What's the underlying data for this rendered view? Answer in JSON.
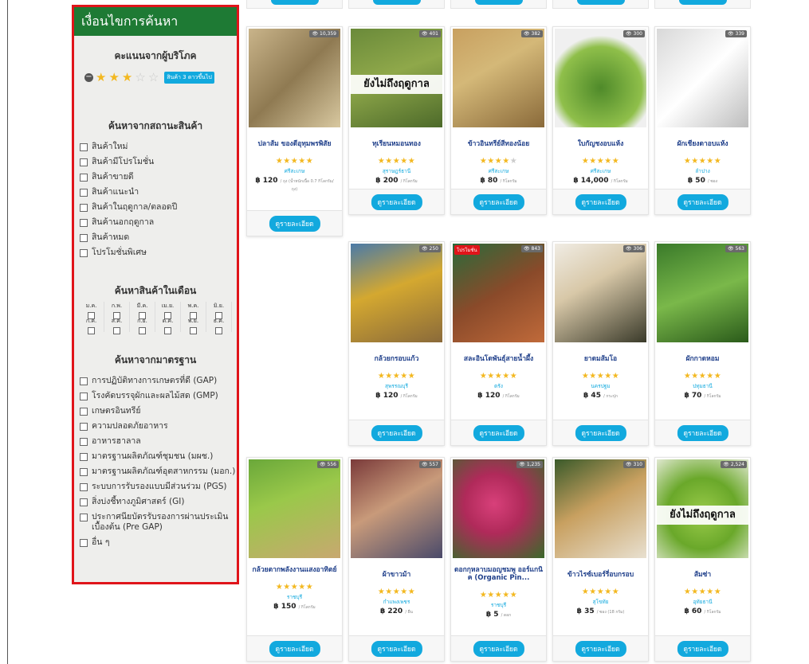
{
  "sidebar": {
    "title": "เงื่อนไขการค้นหา",
    "rating_heading": "คะแนนจากผู้บริโภค",
    "rating_badge": "สินค้า 3 ดาวขึ้นไป",
    "status_heading": "ค้นหาจากสถานะสินค้า",
    "status_items": [
      "สินค้าใหม่",
      "สินค้ามีโปรโมชั่น",
      "สินค้าขายดี",
      "สินค้าแนะนำ",
      "สินค้าในฤดูกาล/ตลอดปี",
      "สินค้านอกฤดูกาล",
      "สินค้าหมด",
      "โปรโมชั่นพิเศษ"
    ],
    "month_heading": "ค้นหาสินค้าในเดือน",
    "months": [
      "ม.ค.",
      "ก.พ.",
      "มี.ค.",
      "เม.ย.",
      "พ.ค.",
      "มิ.ย.",
      "ก.ค.",
      "ส.ค.",
      "ก.ย.",
      "ต.ค.",
      "พ.ย.",
      "ธ.ค."
    ],
    "standard_heading": "ค้นหาจากมาตรฐาน",
    "standard_items": [
      "การปฏิบัติทางการเกษตรที่ดี (GAP)",
      "โรงคัดบรรจุผักและผลไม้สด (GMP)",
      "เกษตรอินทรีย์",
      "ความปลอดภัยอาหาร",
      "อาหารฮาลาล",
      "มาตรฐานผลิตภัณฑ์ชุมชน (มผช.)",
      "มาตรฐานผลิตภัณฑ์อุตสาหกรรม (มอก.)",
      "ระบบการรับรองแบบมีส่วนร่วม (PGS)",
      "สิ่งบ่งชี้ทางภูมิศาสตร์ (GI)",
      "ประกาศนียบัตรรับรองการผ่านประเมินเบื้องต้น (Pre GAP)",
      "อื่น ๆ"
    ]
  },
  "detail_label": "ดูรายละเอียด",
  "off_season_label": "ยังไม่ถึงฤดูกาล",
  "promo_label": "โปรโมชั่น",
  "products": [
    {
      "name": "ปลาส้ม ของดีอุทุมพรพิสัย",
      "views": "10,359",
      "stars": 5,
      "province": "ศรีสะเกษ",
      "price": "฿ 120",
      "unit": "/ ถุง (น้ำหนักเนื้อ 0.7 กิโลกรัม/",
      "unit2": "ถุง)"
    },
    {
      "name": "ทุเรียนหมอนทอง",
      "views": "401",
      "stars": 5,
      "province": "สุราษฎร์ธานี",
      "price": "฿ 200",
      "unit": "/ กิโลกรัม",
      "off_season": true
    },
    {
      "name": "ข้าวอินทรีย์สีทองน้อย",
      "views": "382",
      "stars": 4,
      "province": "ศรีสะเกษ",
      "price": "฿ 80",
      "unit": "/ กิโลกรัม"
    },
    {
      "name": "ใบกัญชงอบแห้ง",
      "views": "300",
      "stars": 5,
      "province": "ศรีสะเกษ",
      "price": "฿ 14,000",
      "unit": "/ กิโลกรัม"
    },
    {
      "name": "ผักเชียงดาอบแห้ง",
      "views": "339",
      "stars": 5,
      "province": "ลำปาง",
      "price": "฿ 50",
      "unit": "/ ซอง"
    },
    {
      "name": "กล้วยกรอบแก้ว",
      "views": "250",
      "stars": 5,
      "province": "สุพรรณบุรี",
      "price": "฿ 120",
      "unit": "/ กิโลกรัม"
    },
    {
      "name": "สละอินโดพันธุ์สายน้ำผึ้ง",
      "views": "843",
      "stars": 5,
      "province": "ตรัง",
      "price": "฿ 120",
      "unit": "/ กิโลกรัม",
      "promo": true
    },
    {
      "name": "ยาดมส้มโอ",
      "views": "306",
      "stars": 5,
      "province": "นครปฐม",
      "price": "฿ 45",
      "unit": "/ กระปุก"
    },
    {
      "name": "ผักกาดหอม",
      "views": "563",
      "stars": 5,
      "province": "ปทุมธานี",
      "price": "฿ 70",
      "unit": "/ กิโลกรัม"
    },
    {
      "name": "กล้วยตากพลังงานแสงอาทิตย์",
      "views": "556",
      "stars": 5,
      "province": "ราชบุรี",
      "price": "฿ 150",
      "unit": "/ กิโลกรัม"
    },
    {
      "name": "ผ้าขาวม้า",
      "views": "557",
      "stars": 5,
      "province": "กำแพงเพชร",
      "price": "฿ 220",
      "unit": "/ ผืน"
    },
    {
      "name": "ดอกกุหลาบมอญชมพู ออร์แกนิค (Organic Pin...",
      "views": "1,235",
      "stars": 5,
      "province": "ราชบุรี",
      "price": "฿ 5",
      "unit": "/ ดอก"
    },
    {
      "name": "ข้าวไรซ์เบอร์รี่อบกรอบ",
      "views": "310",
      "stars": 5,
      "province": "สุโขทัย",
      "price": "฿ 35",
      "unit": "/ ซอง (18 กรัม)"
    },
    {
      "name": "ส้มซ่า",
      "views": "2,524",
      "stars": 5,
      "province": "อุทัยธานี",
      "price": "฿ 60",
      "unit": "/ กิโลกรัม",
      "off_season": true
    }
  ],
  "colors": {
    "sidebar_header": "#1e7a34",
    "sidebar_border": "#e0141a",
    "accent": "#12a9de",
    "star": "#f3b820",
    "name": "#1f3f8a"
  }
}
